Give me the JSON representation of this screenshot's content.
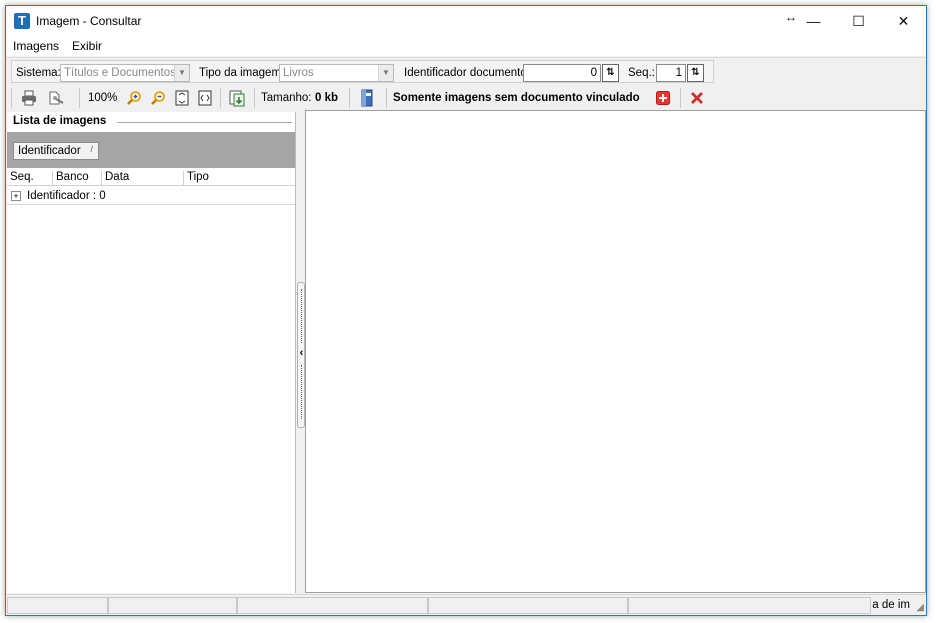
{
  "window": {
    "title": "Imagem - Consultar",
    "app_icon_letter": "T",
    "controls": {
      "resize": "↔",
      "minimize": "—",
      "maximize": "☐",
      "close": "✕"
    }
  },
  "menu": {
    "items": [
      "Imagens",
      "Exibir"
    ]
  },
  "toolbar1": {
    "sistema_label": "Sistema:",
    "sistema_value": "Títulos e Documentos",
    "tipo_label": "Tipo da imagem:",
    "tipo_value": "Livros",
    "identificador_label": "Identificador documento:",
    "identificador_value": "0",
    "seq_label": "Seq.:",
    "seq_value": "1",
    "spin_glyph": "⇅"
  },
  "toolbar2": {
    "zoom_label": "100%",
    "tamanho_label": "Tamanho:",
    "tamanho_value": "0 kb",
    "filter_label": "Somente imagens sem documento vinculado",
    "icons": {
      "print": "print-icon",
      "scan": "scan-icon",
      "zoom_in": "zoom-in-icon",
      "zoom_out": "zoom-out-icon",
      "fit_page": "fit-page-icon",
      "fit_width": "fit-width-icon",
      "export": "export-icon",
      "book": "book-icon",
      "add": "add-icon",
      "remove": "remove-icon"
    },
    "colors": {
      "add": "#e53935",
      "remove": "#d32f2f",
      "zoom": "#f2a400"
    }
  },
  "left_panel": {
    "title": "Lista de imagens",
    "group_by_chip": "Identificador",
    "group_sort_glyph": "/",
    "columns": [
      "Seq.",
      "Banco",
      "Data",
      "Tipo"
    ],
    "group_row": {
      "expander": "+",
      "text": "Identificador : 0"
    }
  },
  "splitter": {
    "arrow": "‹"
  },
  "statusbar": {
    "text": "a de im",
    "grip": "◢"
  }
}
